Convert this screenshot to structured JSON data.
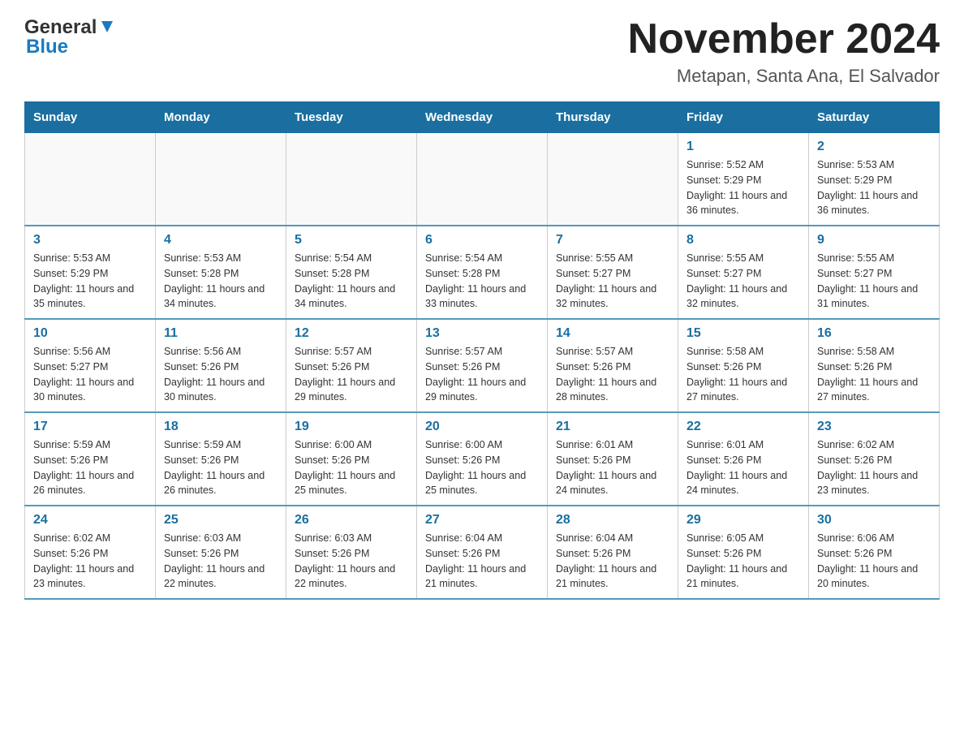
{
  "header": {
    "logo_general": "General",
    "logo_blue": "Blue",
    "title": "November 2024",
    "subtitle": "Metapan, Santa Ana, El Salvador"
  },
  "days_of_week": [
    "Sunday",
    "Monday",
    "Tuesday",
    "Wednesday",
    "Thursday",
    "Friday",
    "Saturday"
  ],
  "weeks": [
    [
      {
        "day": "",
        "info": ""
      },
      {
        "day": "",
        "info": ""
      },
      {
        "day": "",
        "info": ""
      },
      {
        "day": "",
        "info": ""
      },
      {
        "day": "",
        "info": ""
      },
      {
        "day": "1",
        "info": "Sunrise: 5:52 AM\nSunset: 5:29 PM\nDaylight: 11 hours and 36 minutes."
      },
      {
        "day": "2",
        "info": "Sunrise: 5:53 AM\nSunset: 5:29 PM\nDaylight: 11 hours and 36 minutes."
      }
    ],
    [
      {
        "day": "3",
        "info": "Sunrise: 5:53 AM\nSunset: 5:29 PM\nDaylight: 11 hours and 35 minutes."
      },
      {
        "day": "4",
        "info": "Sunrise: 5:53 AM\nSunset: 5:28 PM\nDaylight: 11 hours and 34 minutes."
      },
      {
        "day": "5",
        "info": "Sunrise: 5:54 AM\nSunset: 5:28 PM\nDaylight: 11 hours and 34 minutes."
      },
      {
        "day": "6",
        "info": "Sunrise: 5:54 AM\nSunset: 5:28 PM\nDaylight: 11 hours and 33 minutes."
      },
      {
        "day": "7",
        "info": "Sunrise: 5:55 AM\nSunset: 5:27 PM\nDaylight: 11 hours and 32 minutes."
      },
      {
        "day": "8",
        "info": "Sunrise: 5:55 AM\nSunset: 5:27 PM\nDaylight: 11 hours and 32 minutes."
      },
      {
        "day": "9",
        "info": "Sunrise: 5:55 AM\nSunset: 5:27 PM\nDaylight: 11 hours and 31 minutes."
      }
    ],
    [
      {
        "day": "10",
        "info": "Sunrise: 5:56 AM\nSunset: 5:27 PM\nDaylight: 11 hours and 30 minutes."
      },
      {
        "day": "11",
        "info": "Sunrise: 5:56 AM\nSunset: 5:26 PM\nDaylight: 11 hours and 30 minutes."
      },
      {
        "day": "12",
        "info": "Sunrise: 5:57 AM\nSunset: 5:26 PM\nDaylight: 11 hours and 29 minutes."
      },
      {
        "day": "13",
        "info": "Sunrise: 5:57 AM\nSunset: 5:26 PM\nDaylight: 11 hours and 29 minutes."
      },
      {
        "day": "14",
        "info": "Sunrise: 5:57 AM\nSunset: 5:26 PM\nDaylight: 11 hours and 28 minutes."
      },
      {
        "day": "15",
        "info": "Sunrise: 5:58 AM\nSunset: 5:26 PM\nDaylight: 11 hours and 27 minutes."
      },
      {
        "day": "16",
        "info": "Sunrise: 5:58 AM\nSunset: 5:26 PM\nDaylight: 11 hours and 27 minutes."
      }
    ],
    [
      {
        "day": "17",
        "info": "Sunrise: 5:59 AM\nSunset: 5:26 PM\nDaylight: 11 hours and 26 minutes."
      },
      {
        "day": "18",
        "info": "Sunrise: 5:59 AM\nSunset: 5:26 PM\nDaylight: 11 hours and 26 minutes."
      },
      {
        "day": "19",
        "info": "Sunrise: 6:00 AM\nSunset: 5:26 PM\nDaylight: 11 hours and 25 minutes."
      },
      {
        "day": "20",
        "info": "Sunrise: 6:00 AM\nSunset: 5:26 PM\nDaylight: 11 hours and 25 minutes."
      },
      {
        "day": "21",
        "info": "Sunrise: 6:01 AM\nSunset: 5:26 PM\nDaylight: 11 hours and 24 minutes."
      },
      {
        "day": "22",
        "info": "Sunrise: 6:01 AM\nSunset: 5:26 PM\nDaylight: 11 hours and 24 minutes."
      },
      {
        "day": "23",
        "info": "Sunrise: 6:02 AM\nSunset: 5:26 PM\nDaylight: 11 hours and 23 minutes."
      }
    ],
    [
      {
        "day": "24",
        "info": "Sunrise: 6:02 AM\nSunset: 5:26 PM\nDaylight: 11 hours and 23 minutes."
      },
      {
        "day": "25",
        "info": "Sunrise: 6:03 AM\nSunset: 5:26 PM\nDaylight: 11 hours and 22 minutes."
      },
      {
        "day": "26",
        "info": "Sunrise: 6:03 AM\nSunset: 5:26 PM\nDaylight: 11 hours and 22 minutes."
      },
      {
        "day": "27",
        "info": "Sunrise: 6:04 AM\nSunset: 5:26 PM\nDaylight: 11 hours and 21 minutes."
      },
      {
        "day": "28",
        "info": "Sunrise: 6:04 AM\nSunset: 5:26 PM\nDaylight: 11 hours and 21 minutes."
      },
      {
        "day": "29",
        "info": "Sunrise: 6:05 AM\nSunset: 5:26 PM\nDaylight: 11 hours and 21 minutes."
      },
      {
        "day": "30",
        "info": "Sunrise: 6:06 AM\nSunset: 5:26 PM\nDaylight: 11 hours and 20 minutes."
      }
    ]
  ]
}
